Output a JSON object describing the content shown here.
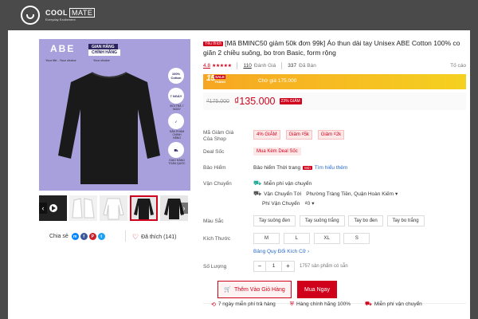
{
  "brand": {
    "name": "COOL",
    "name_box": "MATE",
    "tagline": "Everyday Excitement"
  },
  "gallery": {
    "abe_logo": "ABE",
    "badge_top": "GIAN HÀNG",
    "badge_bottom": "CHÍNH HÃNG",
    "slogan_left": "Your life - Your choice",
    "slogan_right": "Your choice",
    "side_icons": [
      {
        "text": "100% Cotton",
        "label": ""
      },
      {
        "text": "7 NGÀY",
        "label": "ĐỔI TRẢ 7 NGÀY"
      },
      {
        "text": "",
        "label": "SẢN PHẨM CHÍNH HÃNG"
      },
      {
        "text": "",
        "label": "GIAO HÀNG TOÀN QUỐC"
      }
    ],
    "thumb_count": 5,
    "selected_thumb": 3
  },
  "share": {
    "label": "Chia sẻ",
    "icons": [
      "messenger-icon",
      "facebook-icon",
      "pinterest-icon",
      "twitter-icon"
    ],
    "colors": [
      "#0084ff",
      "#3b5998",
      "#cb2027",
      "#1da1f2"
    ]
  },
  "like": {
    "label": "Đã thích (141)"
  },
  "product": {
    "tag": "Yêu thích",
    "title": "[Mã BMINC50 giảm 50k đơn 99k] Áo thun dài tay Unisex ABE Cotton 100% co giãn 2 chiều suông, bo tron Basic, form rộng",
    "rating": "4.8",
    "stars": "★★★★★",
    "review_count": "110",
    "review_label": "Đánh Giá",
    "sold_count": "337",
    "sold_label": "Đã Bán",
    "report_label": "Tố cáo"
  },
  "flash_sale": {
    "number": "15",
    "sale_label": "SALE",
    "day_label": "THÁNG",
    "text": "Chờ giá 175.000"
  },
  "price": {
    "old": "₫175.000",
    "new": "₫135.000",
    "discount": "23% GIẢM"
  },
  "vouchers": {
    "label": "Mã Giảm Giá Của Shop",
    "items": [
      "4% GIẢM",
      "Giảm ₫5k",
      "Giảm ₫2k"
    ]
  },
  "deal": {
    "label": "Deal Sốc",
    "value": "Mua Kèm Deal Sốc"
  },
  "insurance": {
    "label": "Bảo Hiểm",
    "value": "Bảo hiểm Thời trang",
    "badge": "Mới",
    "link": "Tìm hiểu thêm"
  },
  "shipping": {
    "label": "Vận Chuyển",
    "free": "Miễn phí vận chuyển",
    "to_label": "Vận Chuyển Tới",
    "to_value": "Phường Tràng Tiền, Quận Hoàn Kiếm",
    "fee_label": "Phí Vận Chuyển",
    "fee_value": "₫0"
  },
  "colors": {
    "label": "Màu Sắc",
    "options": [
      "Tay suông đen",
      "Tay suông trắng",
      "Tay bo đen",
      "Tay bo trắng"
    ]
  },
  "sizes": {
    "label": "Kích Thước",
    "options": [
      "M",
      "L",
      "XL",
      "S"
    ],
    "guide": "Bảng Quy Đổi Kích Cỡ"
  },
  "quantity": {
    "label": "Số Lượng",
    "minus": "−",
    "value": "1",
    "plus": "+",
    "stock": "1757 sản phẩm có sẵn"
  },
  "actions": {
    "add_cart": "Thêm Vào Giỏ Hàng",
    "buy_now": "Mua Ngay"
  },
  "guarantees": [
    "7 ngày miễn phí trả hàng",
    "Hàng chính hãng 100%",
    "Miễn phí vận chuyển"
  ]
}
